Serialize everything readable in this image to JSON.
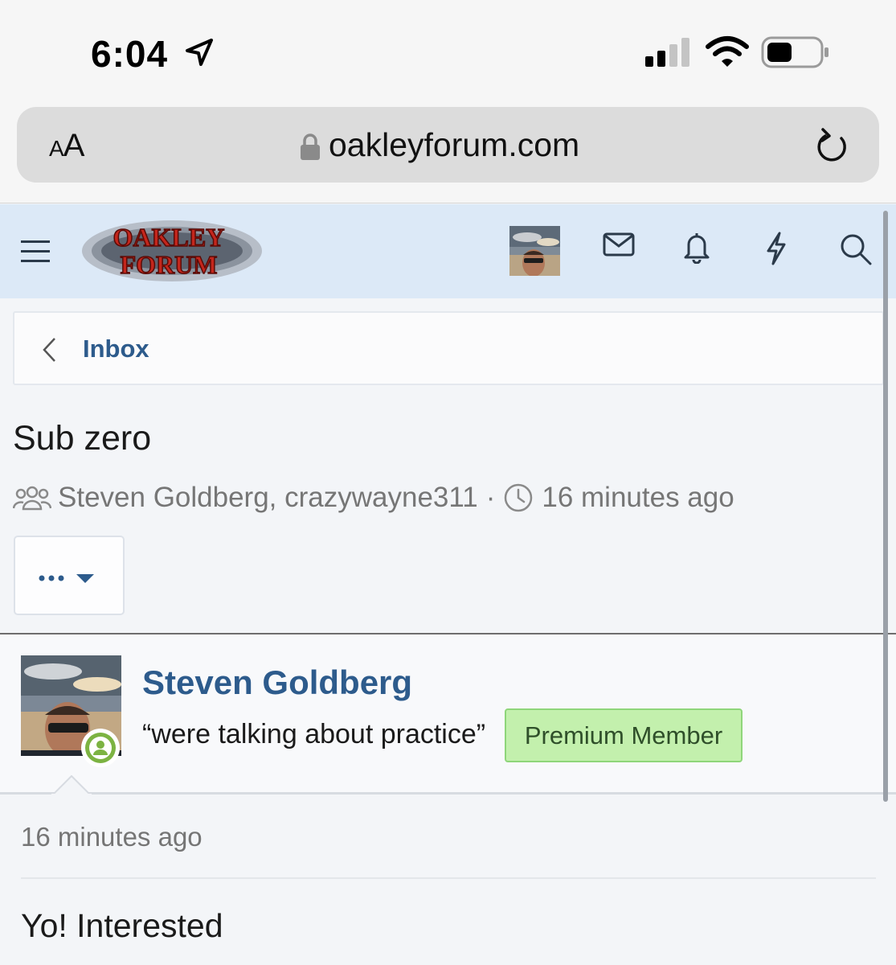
{
  "status_bar": {
    "time": "6:04",
    "icons": [
      "location-arrow-icon",
      "cellular-signal-icon",
      "wifi-icon",
      "battery-icon"
    ]
  },
  "browser": {
    "text_size_label": "AA",
    "url": "oakleyforum.com",
    "icons": [
      "lock-icon",
      "reload-icon"
    ]
  },
  "forum_header": {
    "logo_line1": "OAKLEY",
    "logo_line2": "FORUM",
    "icons": [
      "menu-icon",
      "avatar",
      "envelope-icon",
      "bell-icon",
      "lightning-icon",
      "search-icon"
    ]
  },
  "breadcrumb": {
    "link": "Inbox"
  },
  "conversation": {
    "title": "Sub zero",
    "participants": "Steven Goldberg, crazywayne311",
    "separator": "·",
    "started": "16 minutes ago"
  },
  "more_button": {
    "label": "•••"
  },
  "message": {
    "author": "Steven Goldberg",
    "user_title": "“were talking about practice”",
    "badge": "Premium Member",
    "time": "16 minutes ago",
    "body_line1": "Yo! Interested",
    "body_line2": ""
  },
  "colors": {
    "link_blue": "#2d5b8c",
    "header_bg": "#dce9f7",
    "premium_badge_bg": "#c3f0ad",
    "online_green": "#7cb342"
  }
}
